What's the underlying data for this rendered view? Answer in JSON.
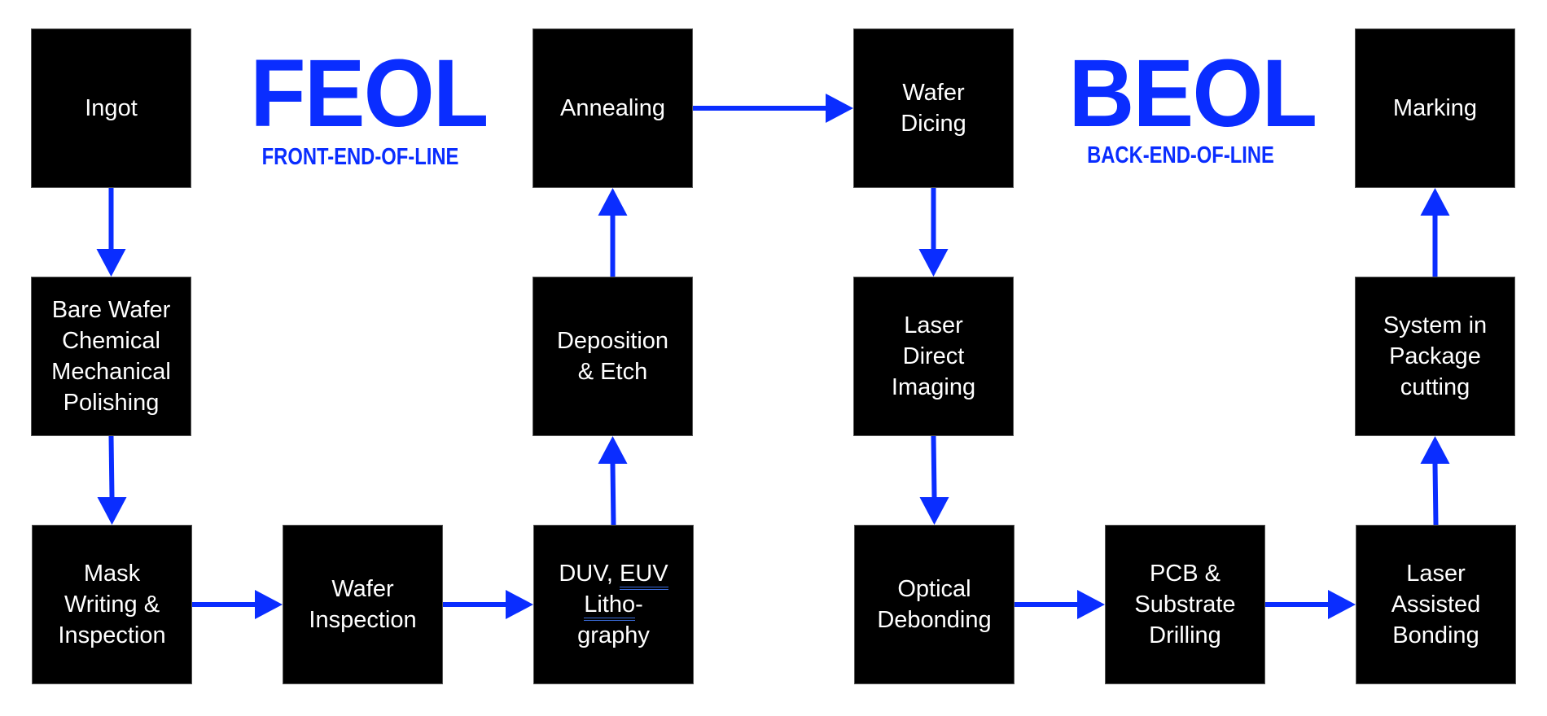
{
  "colors": {
    "arrow": "#0a2dff",
    "box": "#000000",
    "box_text": "#ffffff",
    "title": "#0a2dff"
  },
  "feol": {
    "title": "FEOL",
    "subtitle": "FRONT-END-OF-LINE"
  },
  "beol": {
    "title": "BEOL",
    "subtitle": "BACK-END-OF-LINE"
  },
  "steps": {
    "ingot": [
      "Ingot"
    ],
    "bare_wafer_cmp": [
      "Bare Wafer",
      "Chemical",
      "Mechanical",
      "Polishing"
    ],
    "mask_writing": [
      "Mask",
      "Writing &",
      "Inspection"
    ],
    "wafer_inspection": [
      "Wafer",
      "Inspection"
    ],
    "lithography": [
      "DUV, EUV",
      "Litho-",
      "graphy"
    ],
    "deposition_etch": [
      "Deposition",
      "& Etch"
    ],
    "annealing": [
      "Annealing"
    ],
    "wafer_dicing": [
      "Wafer",
      "Dicing"
    ],
    "laser_direct_imaging": [
      "Laser",
      "Direct",
      "Imaging"
    ],
    "optical_debonding": [
      "Optical",
      "Debonding"
    ],
    "pcb_drilling": [
      "PCB &",
      "Substrate",
      "Drilling"
    ],
    "laser_assisted_bonding": [
      "Laser",
      "Assisted",
      "Bonding"
    ],
    "sip_cutting": [
      "System in",
      "Package",
      "cutting"
    ],
    "marking": [
      "Marking"
    ]
  },
  "flow": [
    [
      "ingot",
      "bare_wafer_cmp"
    ],
    [
      "bare_wafer_cmp",
      "mask_writing"
    ],
    [
      "mask_writing",
      "wafer_inspection"
    ],
    [
      "wafer_inspection",
      "lithography"
    ],
    [
      "lithography",
      "deposition_etch"
    ],
    [
      "deposition_etch",
      "annealing"
    ],
    [
      "annealing",
      "wafer_dicing"
    ],
    [
      "wafer_dicing",
      "laser_direct_imaging"
    ],
    [
      "laser_direct_imaging",
      "optical_debonding"
    ],
    [
      "optical_debonding",
      "pcb_drilling"
    ],
    [
      "pcb_drilling",
      "laser_assisted_bonding"
    ],
    [
      "laser_assisted_bonding",
      "sip_cutting"
    ],
    [
      "sip_cutting",
      "marking"
    ]
  ]
}
